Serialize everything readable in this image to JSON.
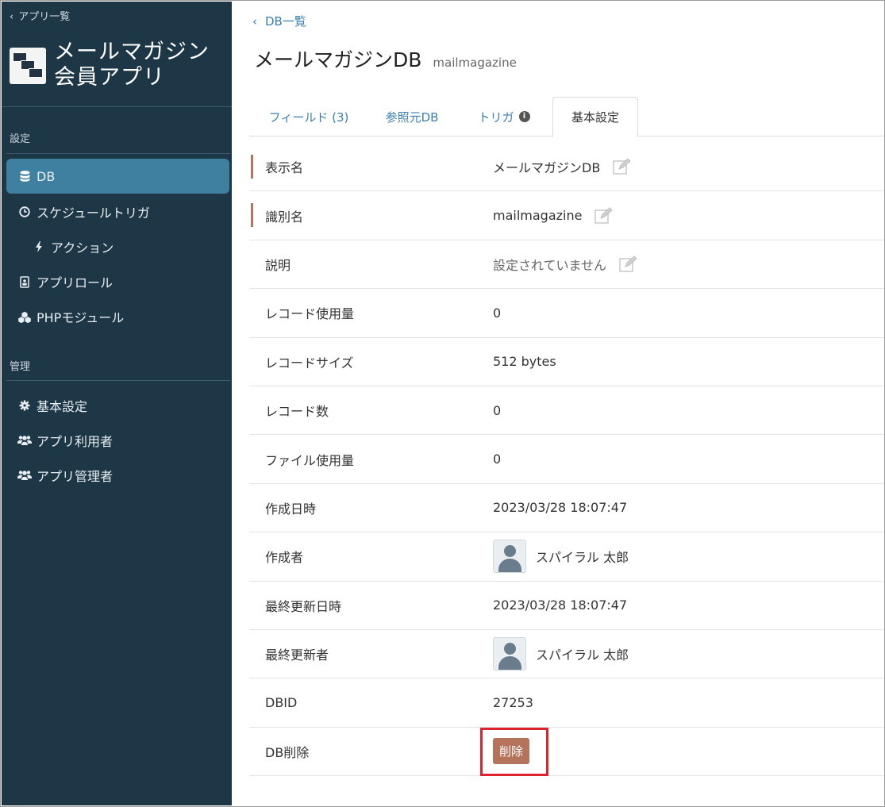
{
  "sidebar": {
    "back_label": "アプリ一覧",
    "app_title_line1": "メールマガジン",
    "app_title_line2": "会員アプリ",
    "section_settings": "設定",
    "section_admin": "管理",
    "items": [
      {
        "label": "DB",
        "icon": "database-icon"
      },
      {
        "label": "スケジュールトリガ",
        "icon": "clock-icon"
      },
      {
        "label": "アクション",
        "icon": "bolt-icon"
      },
      {
        "label": "アプリロール",
        "icon": "id-badge-icon"
      },
      {
        "label": "PHPモジュール",
        "icon": "cubes-icon"
      },
      {
        "label": "基本設定",
        "icon": "gear-icon"
      },
      {
        "label": "アプリ利用者",
        "icon": "users-icon"
      },
      {
        "label": "アプリ管理者",
        "icon": "users-icon"
      }
    ]
  },
  "breadcrumb": {
    "label": "DB一覧"
  },
  "header": {
    "title": "メールマガジンDB",
    "identifier": "mailmagazine"
  },
  "tabs": [
    {
      "label": "フィールド (3)"
    },
    {
      "label": "参照元DB"
    },
    {
      "label": "トリガ"
    },
    {
      "label": "基本設定"
    }
  ],
  "fields": {
    "display_name": {
      "label": "表示名",
      "value": "メールマガジンDB"
    },
    "identifier": {
      "label": "識別名",
      "value": "mailmagazine"
    },
    "description": {
      "label": "説明",
      "value": "設定されていません"
    },
    "record_usage": {
      "label": "レコード使用量",
      "value": "0"
    },
    "record_size": {
      "label": "レコードサイズ",
      "value": "512 bytes"
    },
    "record_count": {
      "label": "レコード数",
      "value": "0"
    },
    "file_usage": {
      "label": "ファイル使用量",
      "value": "0"
    },
    "created_at": {
      "label": "作成日時",
      "value": "2023/03/28 18:07:47"
    },
    "created_by": {
      "label": "作成者",
      "value": "スパイラル 太郎"
    },
    "updated_at": {
      "label": "最終更新日時",
      "value": "2023/03/28 18:07:47"
    },
    "updated_by": {
      "label": "最終更新者",
      "value": "スパイラル 太郎"
    },
    "dbid": {
      "label": "DBID",
      "value": "27253"
    },
    "delete": {
      "label": "DB削除",
      "button": "削除"
    }
  },
  "colors": {
    "sidebar_bg": "#1d3746",
    "sidebar_active": "#3f7fa0",
    "link": "#3b7fb0",
    "required_marker": "#b8735c",
    "delete_button": "#b5735c",
    "highlight_box": "#e0212e"
  }
}
